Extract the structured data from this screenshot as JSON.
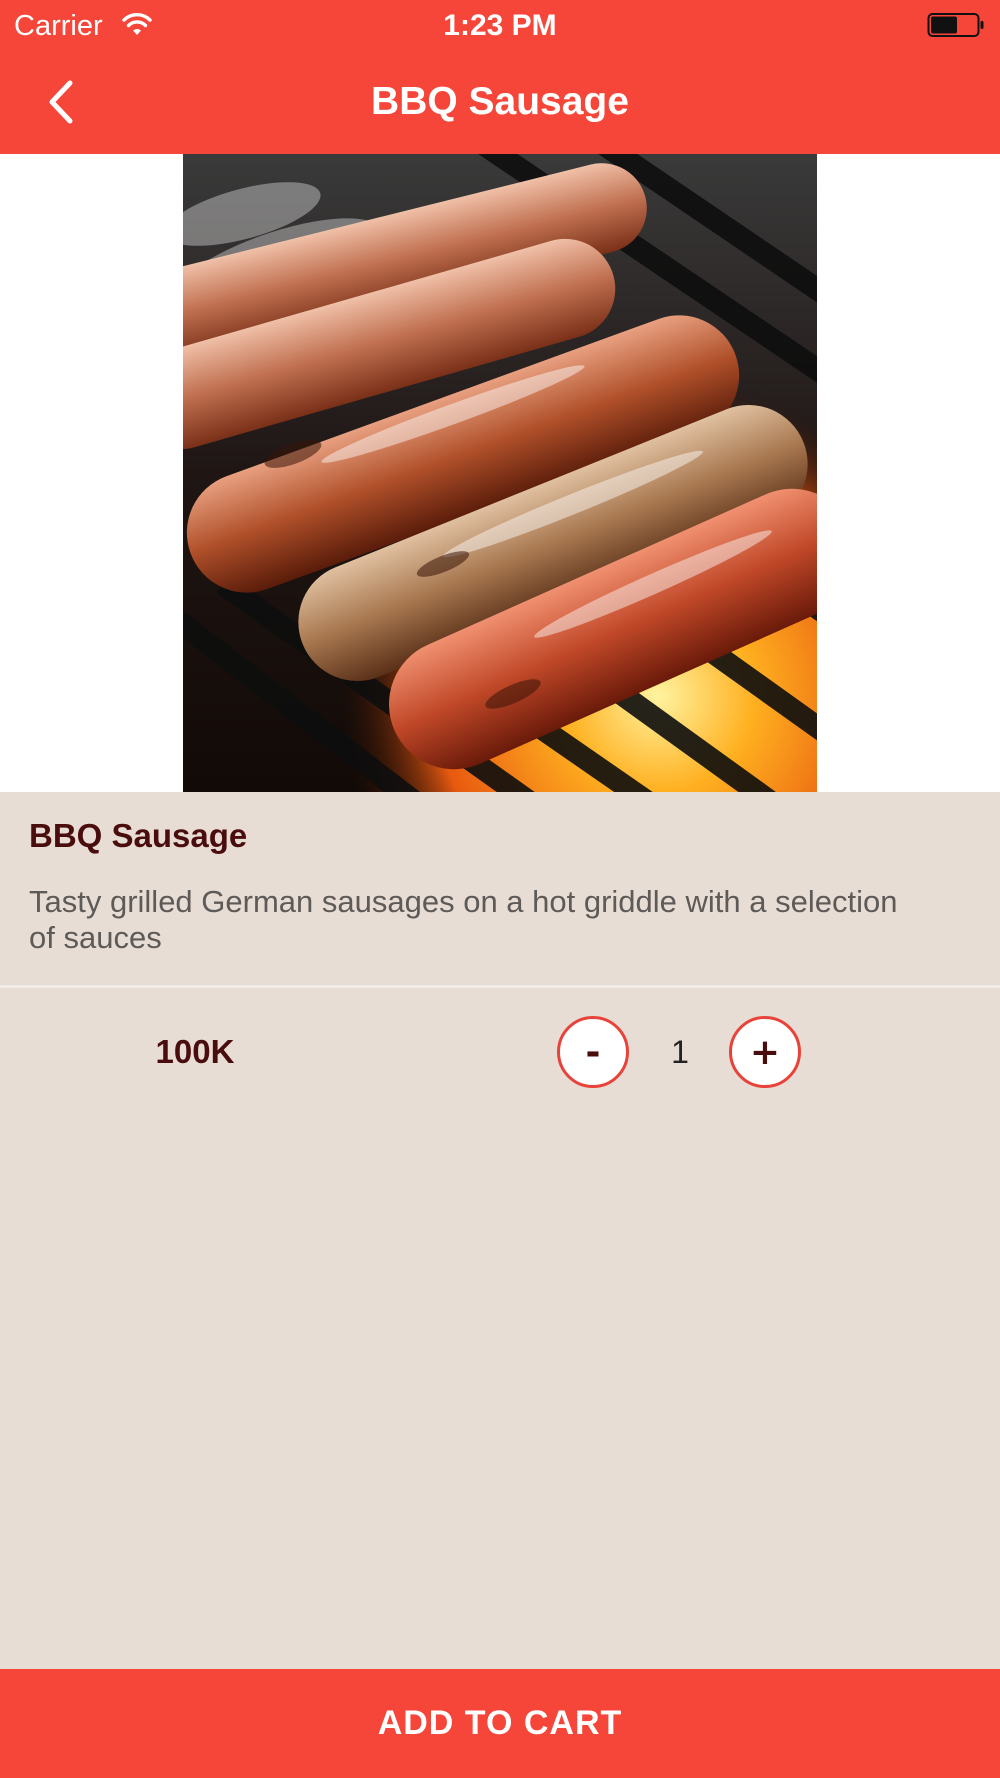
{
  "status_bar": {
    "carrier": "Carrier",
    "time": "1:23 PM",
    "wifi_icon": "wifi-icon",
    "battery_icon": "battery-icon"
  },
  "nav": {
    "title": "BBQ Sausage",
    "back_icon": "chevron-left-icon"
  },
  "product": {
    "image_subject": "grilled sausages on barbecue grill",
    "name": "BBQ Sausage",
    "description": "Tasty grilled German sausages on a hot griddle with a selection of sauces",
    "price": "100K"
  },
  "quantity": {
    "minus_label": "-",
    "value": "1",
    "plus_label": "+"
  },
  "cart_button": {
    "label": "ADD TO CART"
  },
  "colors": {
    "brand_red": "#f54639",
    "background": "#e8ddd5",
    "title_text": "#4a0d0d",
    "body_text": "#5e5a58"
  }
}
